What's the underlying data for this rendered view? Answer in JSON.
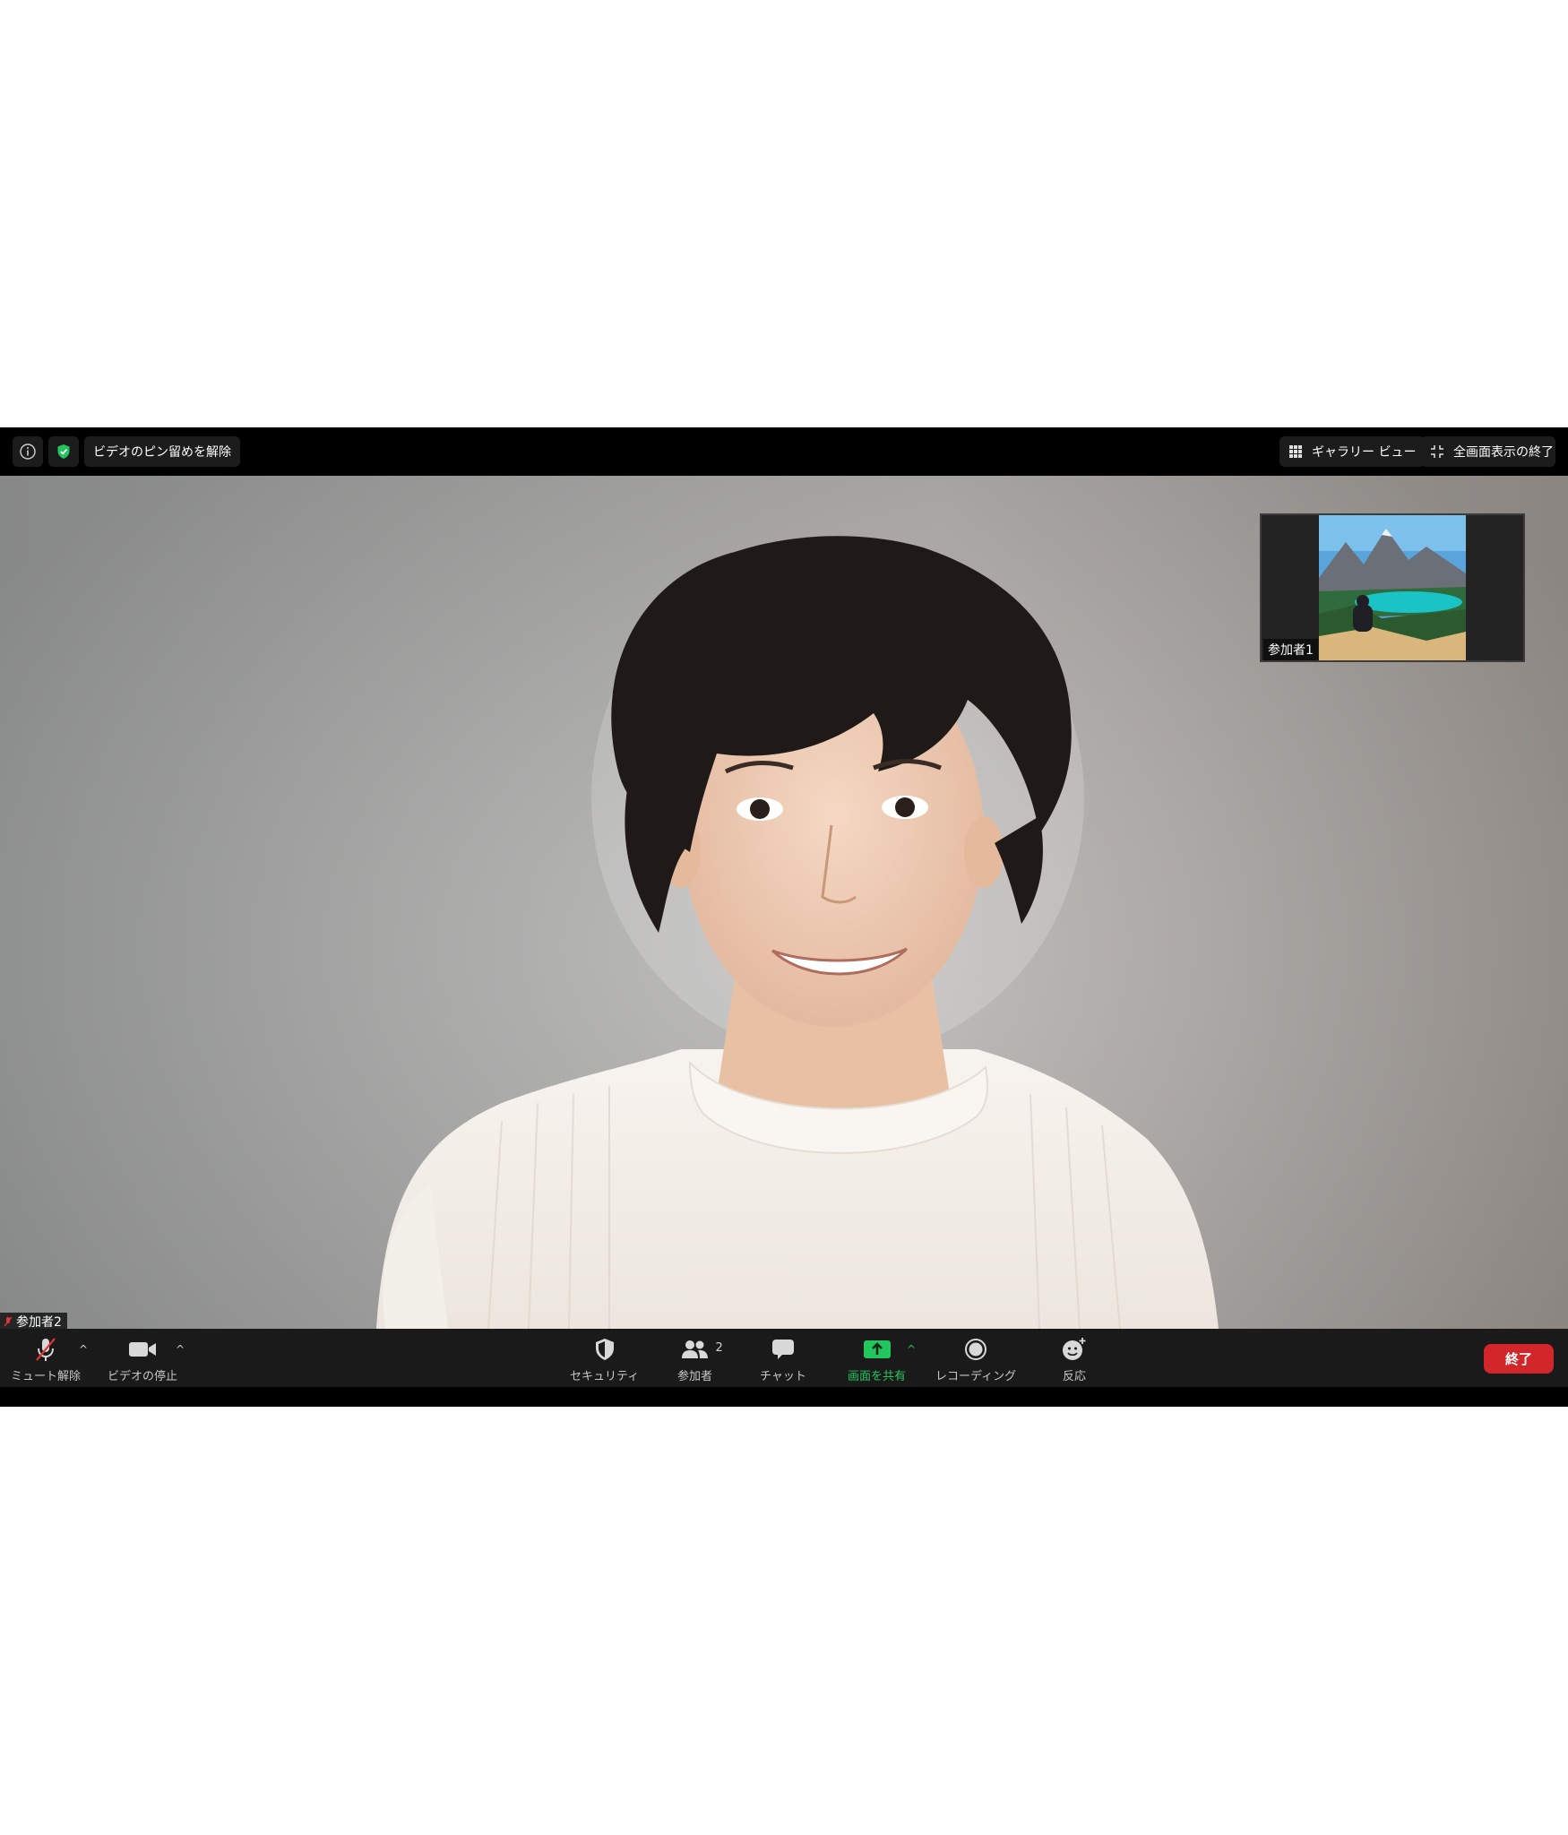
{
  "topbar": {
    "unpin_label": "ビデオのピン留めを解除",
    "gallery_label": "ギャラリー ビュー",
    "exit_fullscreen_label": "全画面表示の終了",
    "icons": [
      "info-icon",
      "shield-check-icon",
      "grid-icon",
      "collapse-icon"
    ]
  },
  "video": {
    "thumbnail_label": "参加者1",
    "speaker_label": "参加者2"
  },
  "toolbar": {
    "unmute_label": "ミュート解除",
    "stop_video_label": "ビデオの停止",
    "security_label": "セキュリティ",
    "participants_label": "参加者",
    "participants_count": "2",
    "chat_label": "チャット",
    "share_screen_label": "画面を共有",
    "record_label": "レコーディング",
    "reactions_label": "反応",
    "end_label": "終了"
  },
  "colors": {
    "accent_green": "#22c55e",
    "end_red": "#d1272b",
    "bar_bg": "#1a1a1a"
  }
}
